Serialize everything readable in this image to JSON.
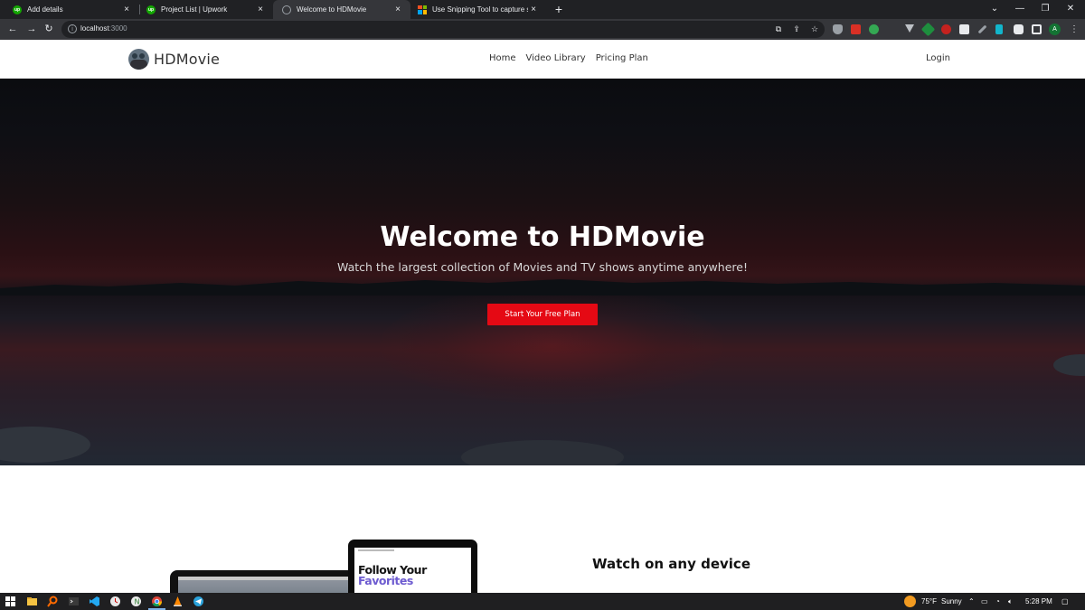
{
  "browser": {
    "tabs": [
      {
        "title": "Add details",
        "favicon": "upwork-icon",
        "active": false
      },
      {
        "title": "Project List | Upwork",
        "favicon": "upwork-icon",
        "active": false
      },
      {
        "title": "Welcome to HDMovie",
        "favicon": "page-icon",
        "active": true
      },
      {
        "title": "Use Snipping Tool to capture scr",
        "favicon": "microsoft-icon",
        "active": false
      }
    ],
    "close_glyph": "×",
    "new_tab_glyph": "+",
    "url_host": "localhost",
    "url_port": ":3000",
    "profile_initial": "A"
  },
  "site": {
    "brand": "HDMovie",
    "nav": {
      "home": "Home",
      "video_library": "Video Library",
      "pricing_plan": "Pricing Plan",
      "login": "Login"
    },
    "hero": {
      "title": "Welcome to HDMovie",
      "subtitle": "Watch the largest collection of Movies and TV shows anytime anywhere!",
      "cta": "Start Your Free Plan"
    },
    "devices": {
      "tablet_line1": "Follow Your",
      "tablet_line2": "Favorites",
      "title": "Watch on any device"
    },
    "colors": {
      "cta": "#e50914",
      "accent_purple": "#6d5bd0"
    }
  },
  "taskbar": {
    "weather_temp": "75°F",
    "weather_text": "Sunny",
    "time": "5:28 PM"
  }
}
